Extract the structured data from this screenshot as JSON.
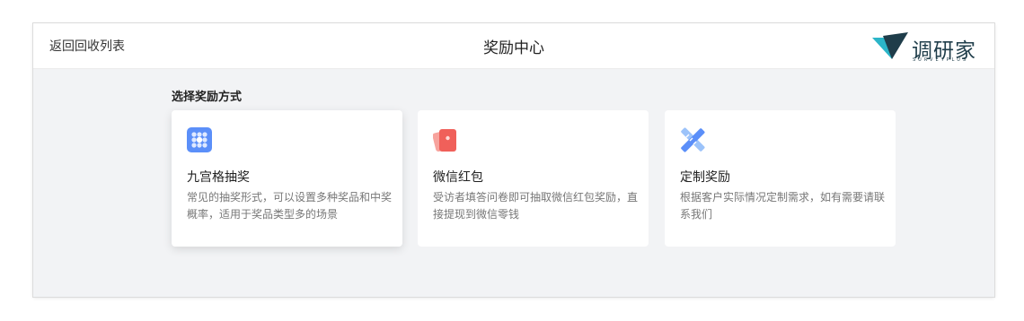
{
  "header": {
    "back_label": "返回回收列表",
    "title": "奖励中心",
    "brand_name": "调研家",
    "brand_sub": "SURVEYPLUS"
  },
  "section": {
    "title": "选择奖励方式"
  },
  "cards": [
    {
      "icon": "grid-lottery-icon",
      "title": "九宫格抽奖",
      "desc": "常见的抽奖形式，可以设置多种奖品和中奖概率，适用于奖品类型多的场景"
    },
    {
      "icon": "red-envelope-icon",
      "title": "微信红包",
      "desc": "受访者填答问卷即可抽取微信红包奖励，直接提现到微信零钱"
    },
    {
      "icon": "ruler-pencil-icon",
      "title": "定制奖励",
      "desc": "根据客户实际情况定制需求，如有需要请联系我们"
    }
  ],
  "colors": {
    "grid_icon": "#5b8ff9",
    "envelope_icon": "#f0605a",
    "ruler_icon": "#6fa8f5",
    "brand_primary": "#1f3d4a",
    "brand_accent": "#2bb5c8"
  }
}
